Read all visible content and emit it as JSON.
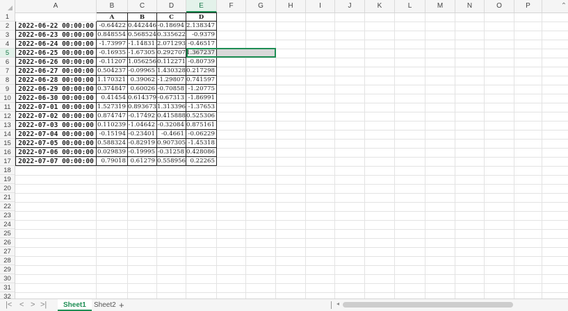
{
  "columns": [
    "A",
    "B",
    "C",
    "D",
    "E",
    "F",
    "G",
    "H",
    "I",
    "J",
    "K",
    "L",
    "M",
    "N",
    "O",
    "P"
  ],
  "active_column": "E",
  "rows": [
    "1",
    "2",
    "3",
    "4",
    "5",
    "6",
    "7",
    "8",
    "9",
    "10",
    "11",
    "12",
    "13",
    "14",
    "15",
    "16",
    "17",
    "18",
    "19",
    "20",
    "21",
    "22",
    "23",
    "24",
    "25",
    "26",
    "27",
    "28",
    "29",
    "30",
    "31",
    "32",
    "33"
  ],
  "active_row": "5",
  "table": {
    "headers": [
      "A",
      "B",
      "C",
      "D"
    ],
    "records": [
      {
        "date": "2022-06-22 00:00:00",
        "v": [
          "-0.64422",
          "0.442446",
          "-0.18694",
          "2.138347"
        ]
      },
      {
        "date": "2022-06-23 00:00:00",
        "v": [
          "0.848554",
          "0.568524",
          "0.335622",
          "-0.9379"
        ]
      },
      {
        "date": "2022-06-24 00:00:00",
        "v": [
          "-1.73997",
          "-1.14831",
          "2.071293",
          "-0.46517"
        ]
      },
      {
        "date": "2022-06-25 00:00:00",
        "v": [
          "-0.16935",
          "-1.67305",
          "0.292707",
          "1.367237"
        ]
      },
      {
        "date": "2022-06-26 00:00:00",
        "v": [
          "-0.11207",
          "1.056256",
          "0.112271",
          "-0.80739"
        ]
      },
      {
        "date": "2022-06-27 00:00:00",
        "v": [
          "0.504237",
          "-0.09965",
          "1.430328",
          "0.217298"
        ]
      },
      {
        "date": "2022-06-28 00:00:00",
        "v": [
          "1.170321",
          "0.39062",
          "-1.29807",
          "0.741597"
        ]
      },
      {
        "date": "2022-06-29 00:00:00",
        "v": [
          "0.374847",
          "0.60026",
          "-0.70858",
          "-1.20775"
        ]
      },
      {
        "date": "2022-06-30 00:00:00",
        "v": [
          "0.41454",
          "0.614379",
          "-0.67313",
          "-1.86991"
        ]
      },
      {
        "date": "2022-07-01 00:00:00",
        "v": [
          "1.527319",
          "0.893673",
          "1.313396",
          "-1.37653"
        ]
      },
      {
        "date": "2022-07-02 00:00:00",
        "v": [
          "0.874747",
          "-0.17492",
          "0.415888",
          "0.525306"
        ]
      },
      {
        "date": "2022-07-03 00:00:00",
        "v": [
          "0.110239",
          "-1.04642",
          "-0.32084",
          "0.875161"
        ]
      },
      {
        "date": "2022-07-04 00:00:00",
        "v": [
          "-0.15194",
          "-0.23401",
          "-0.4661",
          "-0.06229"
        ]
      },
      {
        "date": "2022-07-05 00:00:00",
        "v": [
          "0.588324",
          "-0.82919",
          "0.907305",
          "-1.45318"
        ]
      },
      {
        "date": "2022-07-06 00:00:00",
        "v": [
          "0.029839",
          "-0.19995",
          "-0.31258",
          "0.428086"
        ]
      },
      {
        "date": "2022-07-07 00:00:00",
        "v": [
          "0.79018",
          "0.61279",
          "0.558956",
          "0.22265"
        ]
      }
    ]
  },
  "tabs": {
    "nav": [
      "|<",
      "<",
      ">",
      ">|"
    ],
    "sheet1": "Sheet1",
    "sheet2": "Sheet2",
    "add": "+"
  },
  "colors": {
    "accent": "#1e8e54"
  }
}
